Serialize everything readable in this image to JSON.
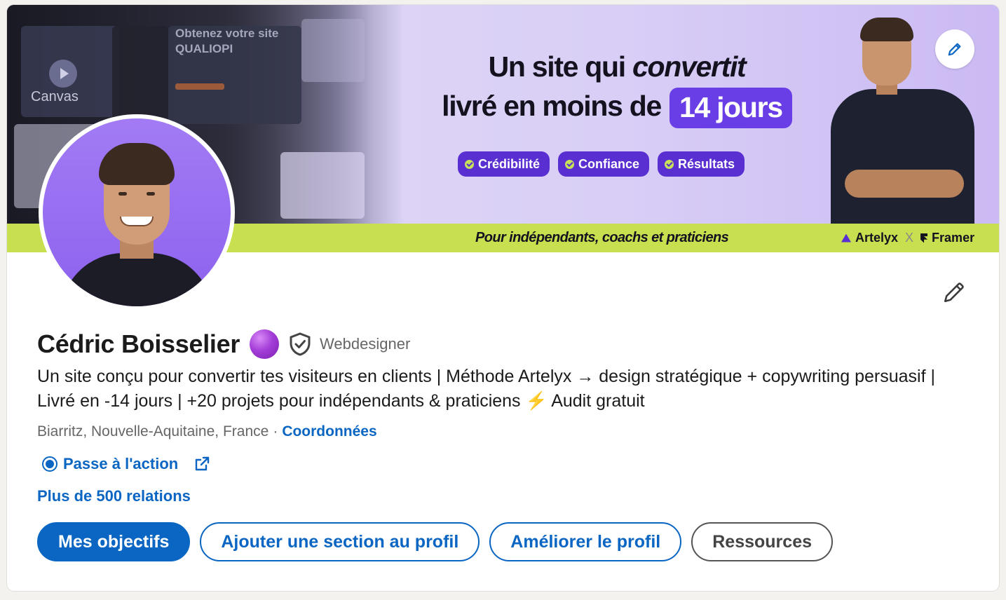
{
  "banner": {
    "headline_line1_a": "Un site qui ",
    "headline_line1_b": "convertit",
    "headline_line2": "livré en moins de",
    "headline_pill": "14 jours",
    "chips": [
      "Crédibilité",
      "Confiance",
      "Résultats"
    ],
    "strip_text": "Pour indépendants, coachs et praticiens",
    "brand_1": "Artelyx",
    "brand_sep": "X",
    "brand_2": "Framer",
    "bg_mock_title": "Obtenez votre site QUALIOPI",
    "bg_mock_canvas": "Canvas",
    "accent_color": "#6a3ee6",
    "strip_color": "#c8e04f"
  },
  "profile": {
    "name": "Cédric Boisselier",
    "pronoun": "Webdesigner",
    "headline": "Un site conçu pour convertir tes visiteurs en clients | Méthode Artelyx → design stratégique + copywriting persuasif | Livré en -14 jours | +20 projets pour indépendants & praticiens ⚡ Audit gratuit",
    "location": "Biarritz, Nouvelle-Aquitaine, France",
    "separator": "·",
    "contact_link": "Coordonnées",
    "website_label": "Passe à l'action",
    "relations": "Plus de 500 relations"
  },
  "actions": {
    "primary": "Mes objectifs",
    "add_section": "Ajouter une section au profil",
    "improve": "Améliorer le profil",
    "resources": "Ressources"
  },
  "colors": {
    "link_blue": "#0a66c2"
  }
}
